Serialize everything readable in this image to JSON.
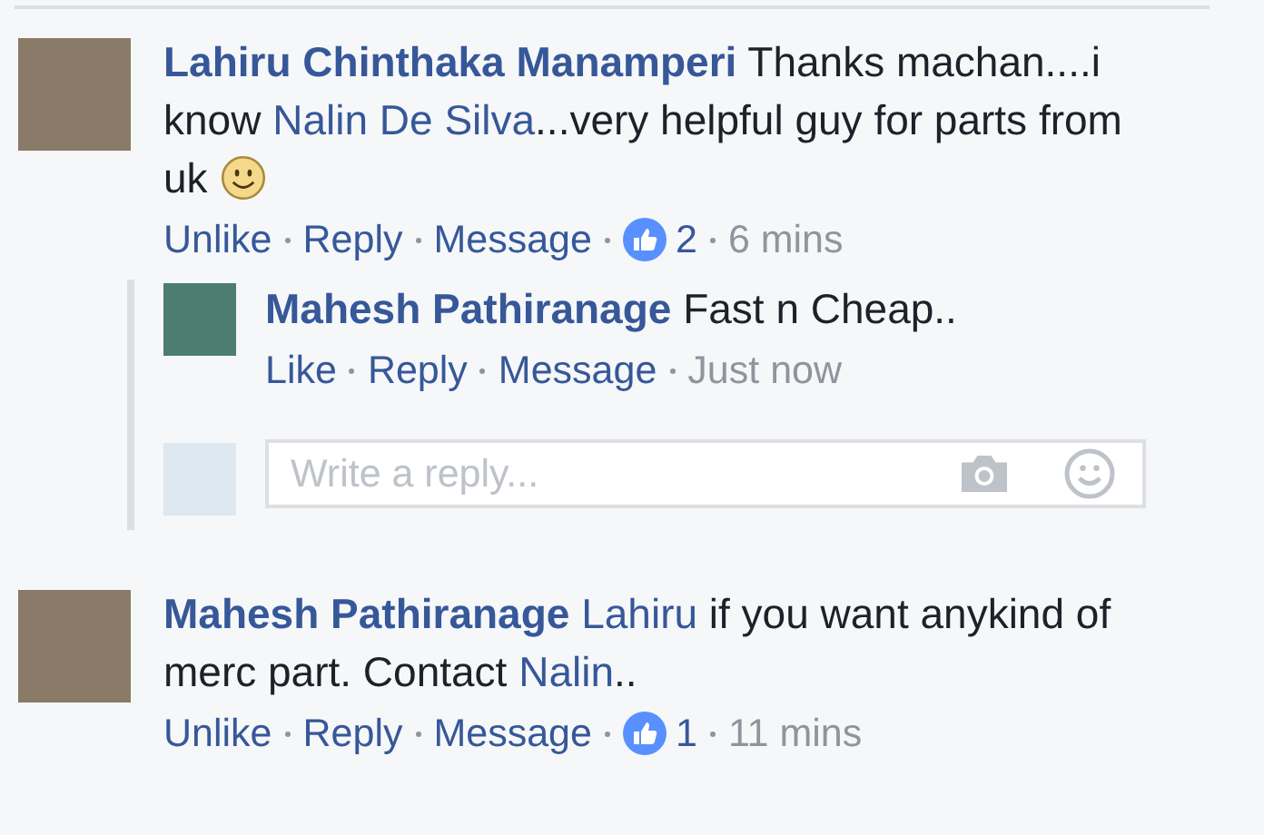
{
  "comments": [
    {
      "author": "Lahiru Chinthaka Manamperi",
      "body": [
        {
          "kind": "text",
          "text": "Thanks machan....i know "
        },
        {
          "kind": "mention",
          "text": "Nalin De Silva"
        },
        {
          "kind": "text",
          "text": "...very helpful guy for parts from uk "
        },
        {
          "kind": "emoji"
        }
      ],
      "actions": [
        {
          "kind": "link",
          "label": "Unlike"
        },
        {
          "kind": "link",
          "label": "Reply"
        },
        {
          "kind": "link",
          "label": "Message"
        },
        {
          "kind": "likes",
          "label": "2"
        },
        {
          "kind": "time",
          "label": "6 mins"
        }
      ],
      "replies": [
        {
          "author": "Mahesh Pathiranage",
          "body": [
            {
              "kind": "text",
              "text": "Fast n Cheap.."
            }
          ],
          "actions": [
            {
              "kind": "link",
              "label": "Like"
            },
            {
              "kind": "link",
              "label": "Reply"
            },
            {
              "kind": "link",
              "label": "Message"
            },
            {
              "kind": "time",
              "label": "Just now"
            }
          ]
        }
      ],
      "reply_box": {
        "placeholder": "Write a reply..."
      }
    },
    {
      "author": "Mahesh Pathiranage",
      "body": [
        {
          "kind": "mention",
          "text": "Lahiru"
        },
        {
          "kind": "text",
          "text": " if you want anykind of merc part. Contact "
        },
        {
          "kind": "mention",
          "text": "Nalin"
        },
        {
          "kind": "text",
          "text": ".."
        }
      ],
      "actions": [
        {
          "kind": "link",
          "label": "Unlike"
        },
        {
          "kind": "link",
          "label": "Reply"
        },
        {
          "kind": "link",
          "label": "Message"
        },
        {
          "kind": "likes",
          "label": "1"
        },
        {
          "kind": "time",
          "label": "11 mins"
        }
      ]
    }
  ]
}
